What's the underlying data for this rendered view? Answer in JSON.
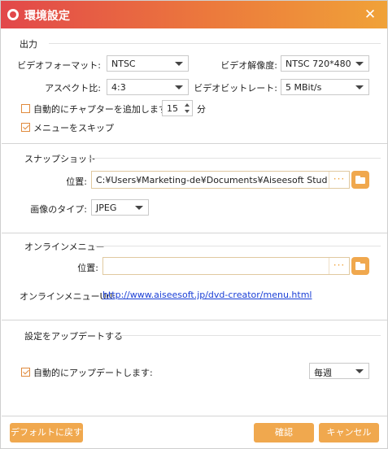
{
  "window": {
    "title": "環境設定",
    "close_icon": "close-icon",
    "logo_icon": "app-logo-icon"
  },
  "output": {
    "section_title": "出力",
    "video_format_label": "ビデオフォーマット:",
    "video_format_value": "NTSC",
    "video_resolution_label": "ビデオ解像度:",
    "video_resolution_value": "NTSC 720*480",
    "aspect_ratio_label": "アスペクト比:",
    "aspect_ratio_value": "4:3",
    "video_bitrate_label": "ビデオビットレート:",
    "video_bitrate_value": "5 MBit/s",
    "auto_chapter_label": "自動的にチャプターを追加します",
    "auto_chapter_checked": false,
    "chapter_interval_value": "15",
    "chapter_interval_unit": "分",
    "skip_menu_label": "メニューをスキップ",
    "skip_menu_checked": true
  },
  "snapshot": {
    "section_title": "スナップショット",
    "location_label": "位置:",
    "location_value": "C:¥Users¥Marketing-de¥Documents¥Aiseesoft Studio¥(",
    "browse_dots": "···",
    "image_type_label": "画像のタイプ:",
    "image_type_value": "JPEG"
  },
  "online_menu": {
    "section_title": "オンラインメニュー",
    "location_label": "位置:",
    "location_value": "",
    "browse_dots": "···",
    "url_label": "オンラインメニューUrl:",
    "url_value": "http://www.aiseesoft.jp/dvd-creator/menu.html"
  },
  "update": {
    "section_title": "設定をアップデートする",
    "auto_update_label": "自動的にアップデートします:",
    "auto_update_checked": true,
    "frequency_value": "毎週"
  },
  "footer": {
    "default_button": "デフォルトに戻す",
    "ok_button": "確認",
    "cancel_button": "キャンセル"
  },
  "colors": {
    "accent": "#f0a84e",
    "title_start": "#e2474a",
    "title_end": "#f0a238",
    "link": "#1a3fd6"
  }
}
